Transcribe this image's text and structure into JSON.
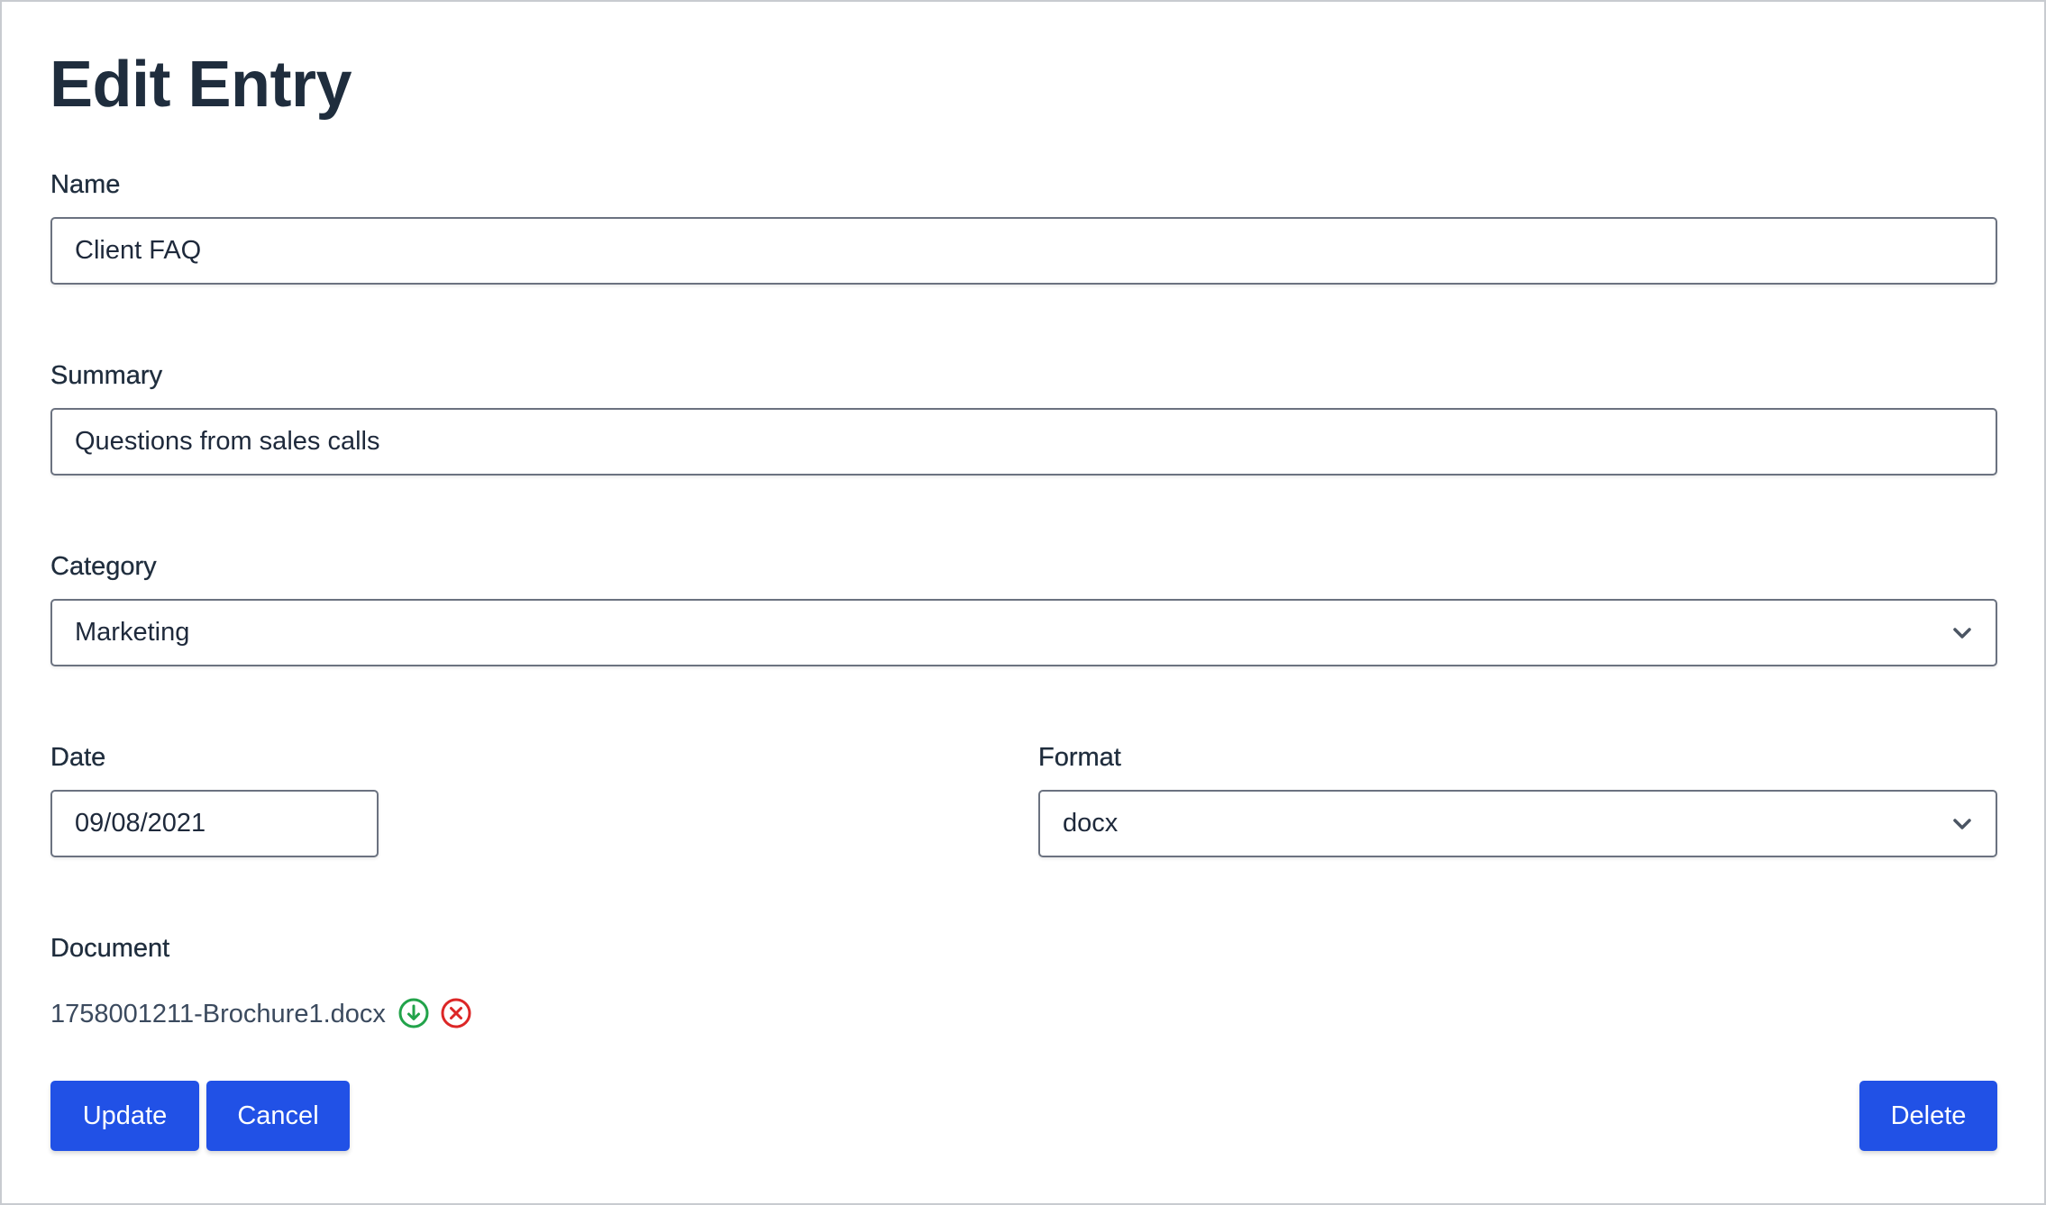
{
  "page": {
    "title": "Edit Entry"
  },
  "form": {
    "name": {
      "label": "Name",
      "value": "Client FAQ"
    },
    "summary": {
      "label": "Summary",
      "value": "Questions from sales calls"
    },
    "category": {
      "label": "Category",
      "value": "Marketing"
    },
    "date": {
      "label": "Date",
      "value": "09/08/2021"
    },
    "format": {
      "label": "Format",
      "value": "docx"
    },
    "document": {
      "label": "Document",
      "filename": "1758001211-Brochure1.docx"
    }
  },
  "icons": {
    "download": "download-circle-icon",
    "remove": "remove-circle-icon",
    "chevron": "chevron-down-icon"
  },
  "colors": {
    "primary_button": "#2151e6",
    "download_icon": "#22a34a",
    "remove_icon": "#dc2626"
  },
  "actions": {
    "update_label": "Update",
    "cancel_label": "Cancel",
    "delete_label": "Delete"
  }
}
